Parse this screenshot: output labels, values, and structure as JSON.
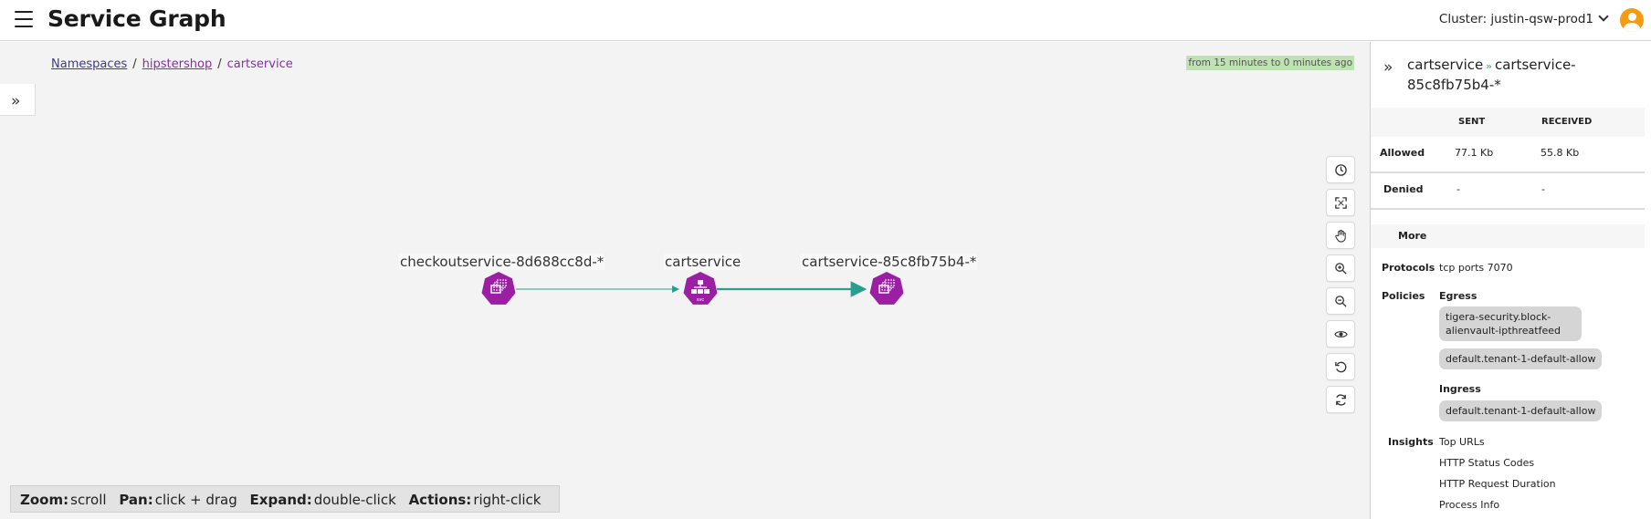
{
  "header": {
    "title": "Service Graph",
    "cluster_label": "Cluster: justin-qsw-prod1"
  },
  "breadcrumb": {
    "items": [
      "Namespaces",
      "hipstershop",
      "cartservice"
    ],
    "separator": "/"
  },
  "time_range": "from 15 minutes to 0 minutes ago",
  "graph": {
    "nodes": [
      {
        "label": "checkoutservice-8d688cc8d-*",
        "icon": "replicaset-icon"
      },
      {
        "label": "cartservice",
        "icon": "service-icon",
        "badge": "svc"
      },
      {
        "label": "cartservice-85c8fb75b4-*",
        "icon": "replicaset-icon"
      }
    ],
    "colors": {
      "node": "#9b1fa3",
      "edge": "#2a9d8f",
      "accent": "#8a2bac"
    }
  },
  "toolbar": {
    "tools": [
      "history-icon",
      "fit-screen-icon",
      "pan-hand-icon",
      "zoom-in-icon",
      "zoom-out-icon",
      "visibility-icon",
      "undo-icon",
      "refresh-icon"
    ]
  },
  "hints": [
    {
      "key": "Zoom:",
      "value": "scroll"
    },
    {
      "key": "Pan:",
      "value": "click + drag"
    },
    {
      "key": "Expand:",
      "value": "double-click"
    },
    {
      "key": "Actions:",
      "value": "right-click"
    }
  ],
  "panel": {
    "title_source": "cartservice",
    "title_arrow": "»",
    "title_dest": "cartservice-85c8fb75b4-*",
    "columns": {
      "sent": "SENT",
      "received": "RECEIVED"
    },
    "rows": [
      {
        "label": "Allowed",
        "sent": "77.1 Kb",
        "received": "55.8 Kb"
      },
      {
        "label": "Denied",
        "sent": "-",
        "received": "-"
      }
    ],
    "more_label": "More",
    "protocols_label": "Protocols",
    "protocols_value": "tcp ports 7070",
    "policies_label": "Policies",
    "egress_label": "Egress",
    "egress_policies": [
      "tigera-security.block-alienvault-ipthreatfeed",
      "default.tenant-1-default-allow"
    ],
    "ingress_label": "Ingress",
    "ingress_policies": [
      "default.tenant-1-default-allow"
    ],
    "insights_label": "Insights",
    "insights": [
      "Top URLs",
      "HTTP Status Codes",
      "HTTP Request Duration",
      "Process Info"
    ]
  }
}
